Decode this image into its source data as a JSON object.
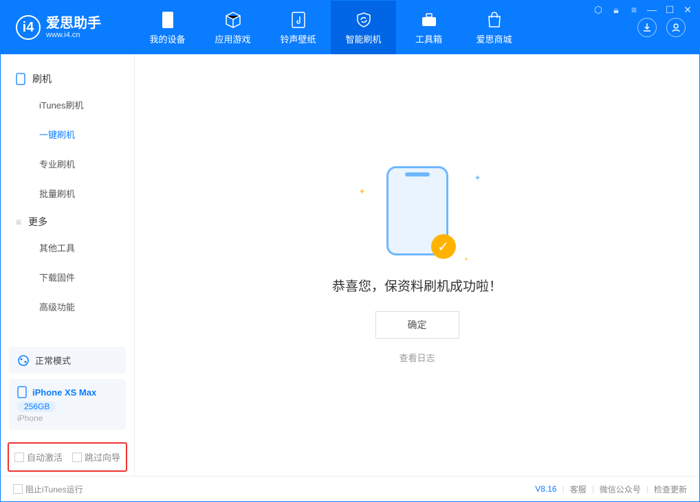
{
  "app": {
    "name": "爱思助手",
    "domain": "www.i4.cn"
  },
  "nav": {
    "items": [
      {
        "label": "我的设备"
      },
      {
        "label": "应用游戏"
      },
      {
        "label": "铃声壁纸"
      },
      {
        "label": "智能刷机"
      },
      {
        "label": "工具箱"
      },
      {
        "label": "爱思商城"
      }
    ]
  },
  "sidebar": {
    "group1": {
      "title": "刷机",
      "items": [
        "iTunes刷机",
        "一键刷机",
        "专业刷机",
        "批量刷机"
      ]
    },
    "group2": {
      "title": "更多",
      "items": [
        "其他工具",
        "下载固件",
        "高级功能"
      ]
    }
  },
  "device": {
    "mode": "正常模式",
    "name": "iPhone XS Max",
    "storage": "256GB",
    "type": "iPhone"
  },
  "options": {
    "auto_activate": "自动激活",
    "skip_guide": "跳过向导"
  },
  "main": {
    "message": "恭喜您，保资料刷机成功啦！",
    "ok": "确定",
    "view_log": "查看日志"
  },
  "footer": {
    "block_itunes": "阻止iTunes运行",
    "version": "V8.16",
    "support": "客服",
    "wechat": "微信公众号",
    "update": "检查更新"
  }
}
